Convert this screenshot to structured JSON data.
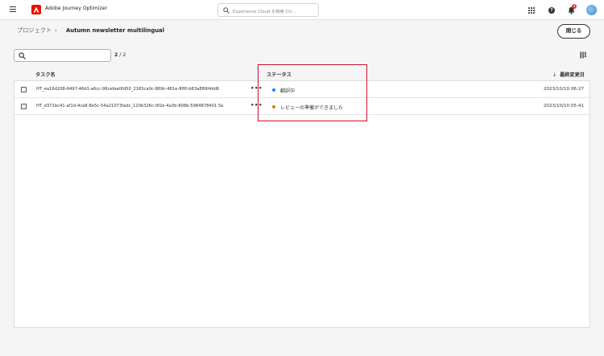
{
  "app": {
    "title": "Adobe Journey Optimizer"
  },
  "search": {
    "placeholder": "Experience Cloud を検索  Ctr..."
  },
  "notifications": {
    "count": "4"
  },
  "help": {
    "glyph": "?"
  },
  "breadcrumb": {
    "parent": "プロジェクト",
    "separator": "›",
    "current": "Autumn newsletter multilingual"
  },
  "close_button": {
    "label": "閉じる"
  },
  "pagination": {
    "current": "2",
    "separator": "/",
    "total": "2"
  },
  "table": {
    "columns": {
      "name": "タスク名",
      "status": "ステータス",
      "date": "最終変更日",
      "sort_arrow": "↓"
    },
    "more_glyph": "•••",
    "rows": [
      {
        "name": "HT_ea16d208-6497-46d1-a6cc-96cefea0fd50_2165ca0c-869c-481e-8ff0-b83a889f4dd6",
        "status": "翻訳中",
        "status_color": "#2680eb",
        "date": "2023/10/10  06:27"
      },
      {
        "name": "HT_d371bc41-af1d-4ce8-8e5c-54a21073fadc_120b326c-0f2e-4a3b-808b-5984878401 5e",
        "status": "レビューの準備ができました",
        "status_color": "#da7b11",
        "date": "2023/10/10  05:41"
      }
    ]
  },
  "colors": {
    "brand": "#eb1000",
    "highlight_box": "#c8102e"
  }
}
